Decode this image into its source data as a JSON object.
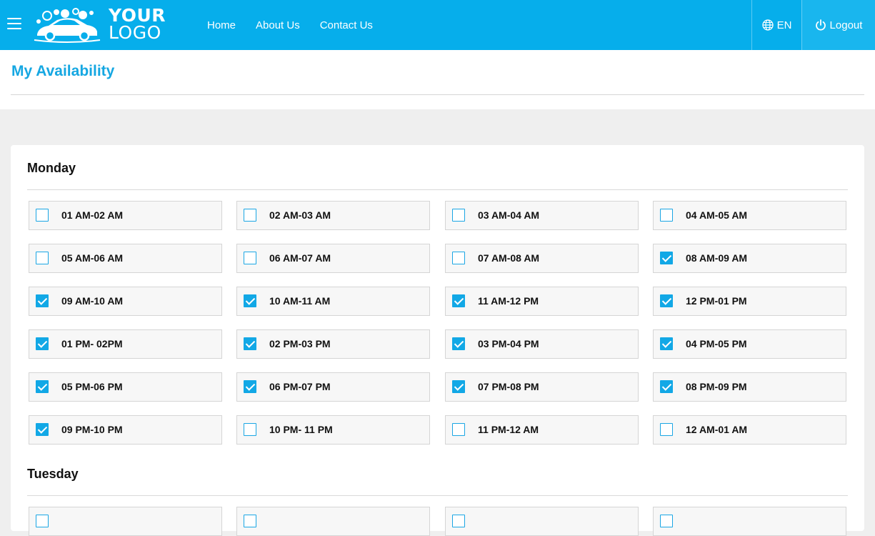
{
  "header": {
    "logo_line1": "YOUR",
    "logo_line2": "LOGO",
    "nav": [
      {
        "label": "Home"
      },
      {
        "label": "About Us"
      },
      {
        "label": "Contact Us"
      }
    ],
    "language": "EN",
    "logout": "Logout"
  },
  "page": {
    "title": "My Availability"
  },
  "colors": {
    "accent": "#06aeeb",
    "title": "#15a7e2",
    "checked": "#12a8e6"
  },
  "days": [
    {
      "name": "Monday",
      "slots": [
        {
          "label": "01 AM-02 AM",
          "checked": false
        },
        {
          "label": "02 AM-03 AM",
          "checked": false
        },
        {
          "label": "03 AM-04 AM",
          "checked": false
        },
        {
          "label": "04 AM-05 AM",
          "checked": false
        },
        {
          "label": "05 AM-06 AM",
          "checked": false
        },
        {
          "label": "06 AM-07 AM",
          "checked": false
        },
        {
          "label": "07 AM-08 AM",
          "checked": false
        },
        {
          "label": "08 AM-09 AM",
          "checked": true
        },
        {
          "label": "09 AM-10 AM",
          "checked": true
        },
        {
          "label": "10 AM-11 AM",
          "checked": true
        },
        {
          "label": "11 AM-12 PM",
          "checked": true
        },
        {
          "label": "12 PM-01 PM",
          "checked": true
        },
        {
          "label": "01 PM- 02PM",
          "checked": true
        },
        {
          "label": "02 PM-03 PM",
          "checked": true
        },
        {
          "label": "03 PM-04 PM",
          "checked": true
        },
        {
          "label": "04 PM-05 PM",
          "checked": true
        },
        {
          "label": "05 PM-06 PM",
          "checked": true
        },
        {
          "label": "06 PM-07 PM",
          "checked": true
        },
        {
          "label": "07 PM-08 PM",
          "checked": true
        },
        {
          "label": "08 PM-09 PM",
          "checked": true
        },
        {
          "label": "09 PM-10 PM",
          "checked": true
        },
        {
          "label": "10 PM- 11 PM",
          "checked": false
        },
        {
          "label": "11 PM-12 AM",
          "checked": false
        },
        {
          "label": "12 AM-01 AM",
          "checked": false
        }
      ]
    },
    {
      "name": "Tuesday",
      "slots": [
        {
          "label": "",
          "checked": false
        },
        {
          "label": "",
          "checked": false
        },
        {
          "label": "",
          "checked": false
        },
        {
          "label": "",
          "checked": false
        }
      ]
    }
  ]
}
